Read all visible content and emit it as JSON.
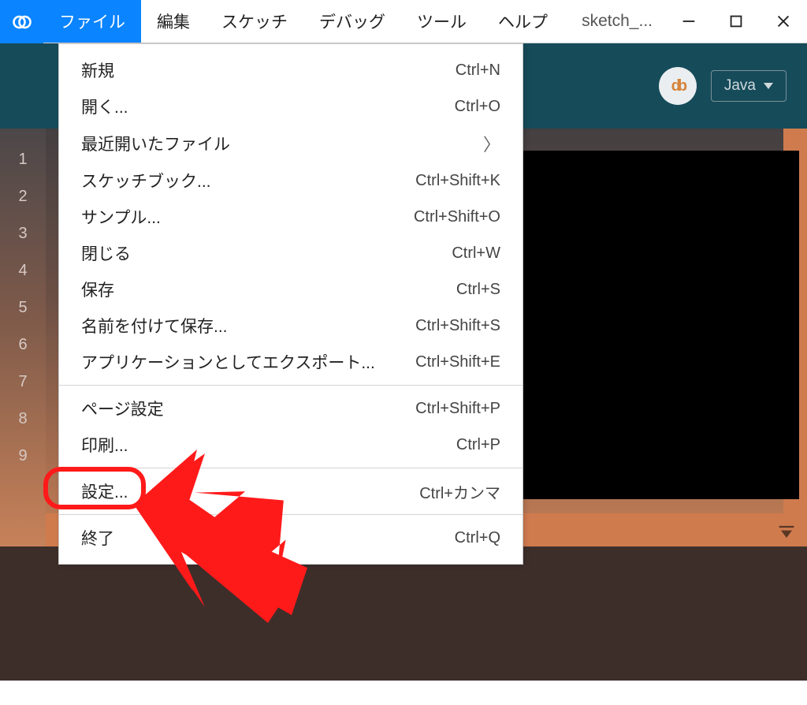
{
  "menubar": {
    "items": [
      "ファイル",
      "編集",
      "スケッチ",
      "デバッグ",
      "ツール",
      "ヘルプ"
    ],
    "active_index": 0,
    "window_title": "sketch_..."
  },
  "toolbar": {
    "avatar_text": "db",
    "mode_label": "Java"
  },
  "gutter": {
    "lines": [
      "1",
      "2",
      "3",
      "4",
      "5",
      "6",
      "7",
      "8",
      "9"
    ]
  },
  "dropdown": {
    "items": [
      {
        "label": "新規",
        "shortcut": "Ctrl+N"
      },
      {
        "label": "開く...",
        "shortcut": "Ctrl+O"
      },
      {
        "label": "最近開いたファイル",
        "submenu": true
      },
      {
        "label": "スケッチブック...",
        "shortcut": "Ctrl+Shift+K"
      },
      {
        "label": "サンプル...",
        "shortcut": "Ctrl+Shift+O"
      },
      {
        "label": "閉じる",
        "shortcut": "Ctrl+W"
      },
      {
        "label": "保存",
        "shortcut": "Ctrl+S"
      },
      {
        "label": "名前を付けて保存...",
        "shortcut": "Ctrl+Shift+S"
      },
      {
        "label": "アプリケーションとしてエクスポート...",
        "shortcut": "Ctrl+Shift+E"
      },
      {
        "sep": true
      },
      {
        "label": "ページ設定",
        "shortcut": "Ctrl+Shift+P"
      },
      {
        "label": "印刷...",
        "shortcut": "Ctrl+P"
      },
      {
        "sep": true
      },
      {
        "label": "設定...",
        "shortcut": "Ctrl+カンマ",
        "highlighted": true
      },
      {
        "sep": true
      },
      {
        "label": "終了",
        "shortcut": "Ctrl+Q"
      }
    ]
  },
  "annotation": {
    "highlight_label": "設定...",
    "arrow_color": "#ff1a1a"
  }
}
